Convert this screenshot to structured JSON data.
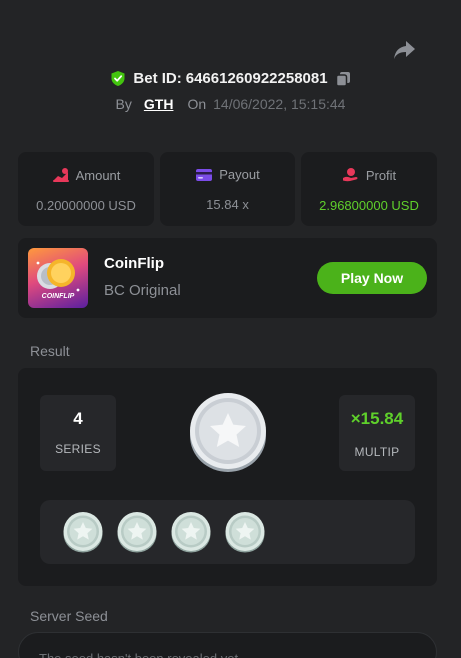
{
  "bet": {
    "label": "Bet ID:",
    "id": "64661260922258081",
    "by_label": "By",
    "user": "GTH",
    "on_label": "On",
    "datetime": "14/06/2022, 15:15:44"
  },
  "stats": {
    "amount": {
      "label": "Amount",
      "value": "0.20000000 USD"
    },
    "payout": {
      "label": "Payout",
      "value": "15.84 x"
    },
    "profit": {
      "label": "Profit",
      "value": "2.96800000 USD"
    }
  },
  "game": {
    "name": "CoinFlip",
    "subtitle": "BC Original",
    "thumb_label": "COINFLIP",
    "play_label": "Play Now"
  },
  "result": {
    "section_label": "Result",
    "series_value": "4",
    "series_label": "SERIES",
    "multiplier_value": "×15.84",
    "multiplier_label": "MULTIP",
    "coins": [
      "silver",
      "silver",
      "silver",
      "silver"
    ]
  },
  "server_seed": {
    "section_label": "Server Seed",
    "placeholder": "The seed hasn't been revealed yet"
  },
  "colors": {
    "background": "#232426",
    "panel": "#1b1c1e",
    "accent_green": "#4bb21a",
    "profit_green": "#5fd02b"
  }
}
